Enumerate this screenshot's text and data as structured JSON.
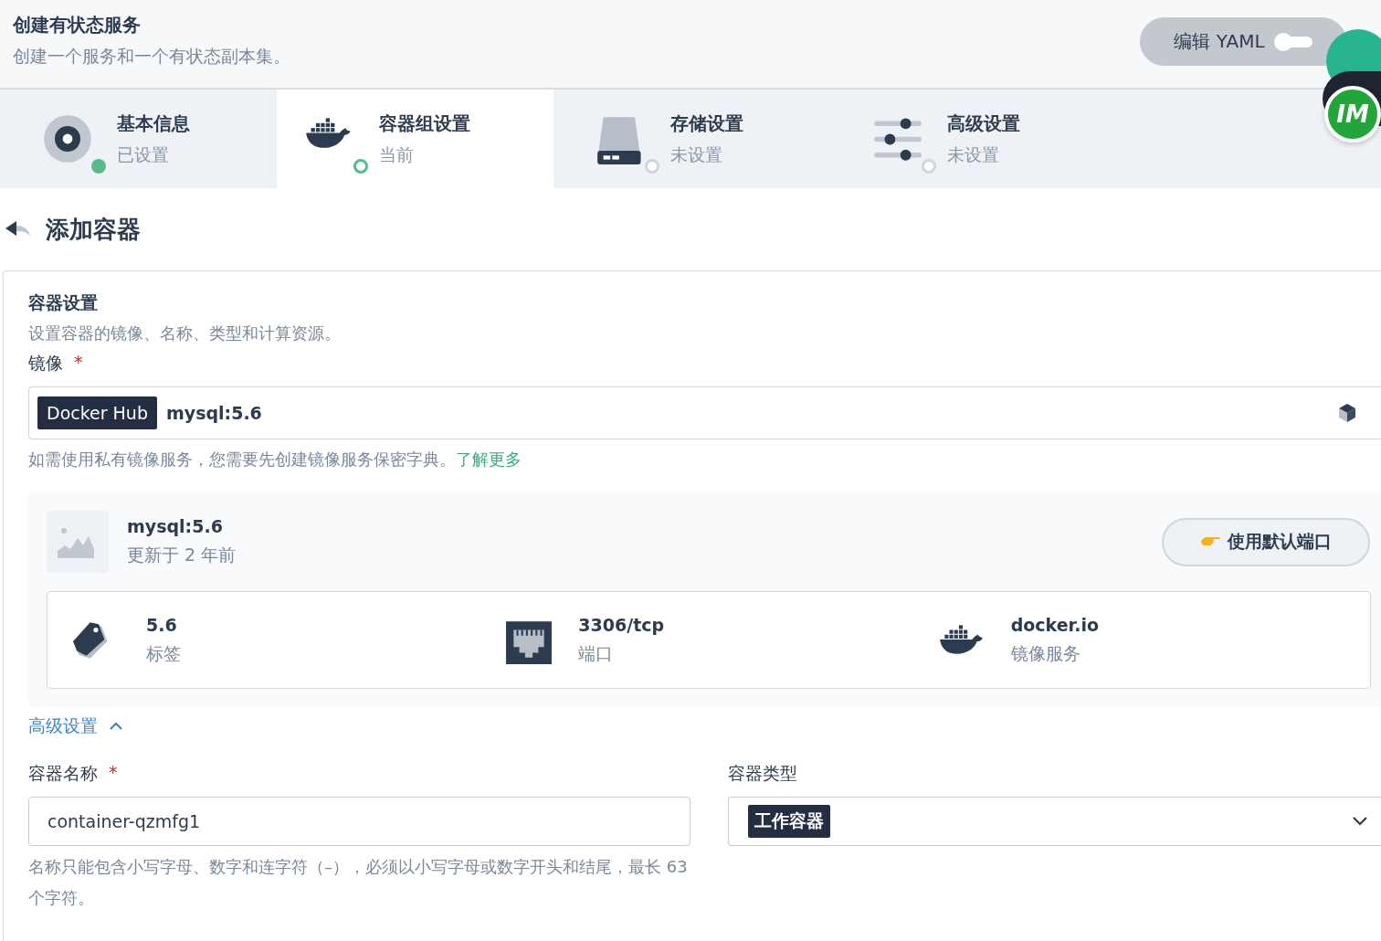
{
  "header": {
    "title": "创建有状态服务",
    "subtitle": "创建一个服务和一个有状态副本集。",
    "yaml_toggle": {
      "label": "编辑 YAML",
      "on": false
    }
  },
  "widget": {
    "logo": "IM"
  },
  "steps": [
    {
      "title": "基本信息",
      "status_text": "已设置",
      "kind": "disc",
      "completed": true,
      "selected": false
    },
    {
      "title": "容器组设置",
      "status_text": "当前",
      "kind": "docker",
      "completed": false,
      "selected": true
    },
    {
      "title": "存储设置",
      "status_text": "未设置",
      "kind": "drive",
      "completed": false,
      "selected": false
    },
    {
      "title": "高级设置",
      "status_text": "未设置",
      "kind": "sliders",
      "completed": false,
      "selected": false
    }
  ],
  "section": {
    "back_title": "添加容器"
  },
  "container_settings": {
    "title": "容器设置",
    "description": "设置容器的镜像、名称、类型和计算资源。",
    "image_label": "镜像",
    "image_required_mark": "*",
    "registry": "Docker Hub",
    "image_value": "mysql:5.6",
    "hint": "如需使用私有镜像服务，您需要先创建镜像服务保密字典。",
    "hint_link": "了解更多",
    "image_info": {
      "name": "mysql:5.6",
      "updated": "更新于 2 年前",
      "button": "使用默认端口",
      "details": [
        {
          "kind": "tag",
          "value": "5.6",
          "label": "标签"
        },
        {
          "kind": "port",
          "value": "3306/tcp",
          "label": "端口"
        },
        {
          "kind": "registry",
          "value": "docker.io",
          "label": "镜像服务"
        }
      ]
    },
    "advanced": {
      "label": "高级设置",
      "expanded": true
    },
    "fields": [
      {
        "label": "容器名称",
        "required_mark": "*",
        "kind": "text",
        "value": "container-qzmfg1",
        "help": "名称只能包含小写字母、数字和连字符（–），必须以小写字母或数字开头和结尾，最长 63 个字符。"
      },
      {
        "label": "容器类型",
        "kind": "select",
        "value": "工作容器"
      }
    ]
  }
}
